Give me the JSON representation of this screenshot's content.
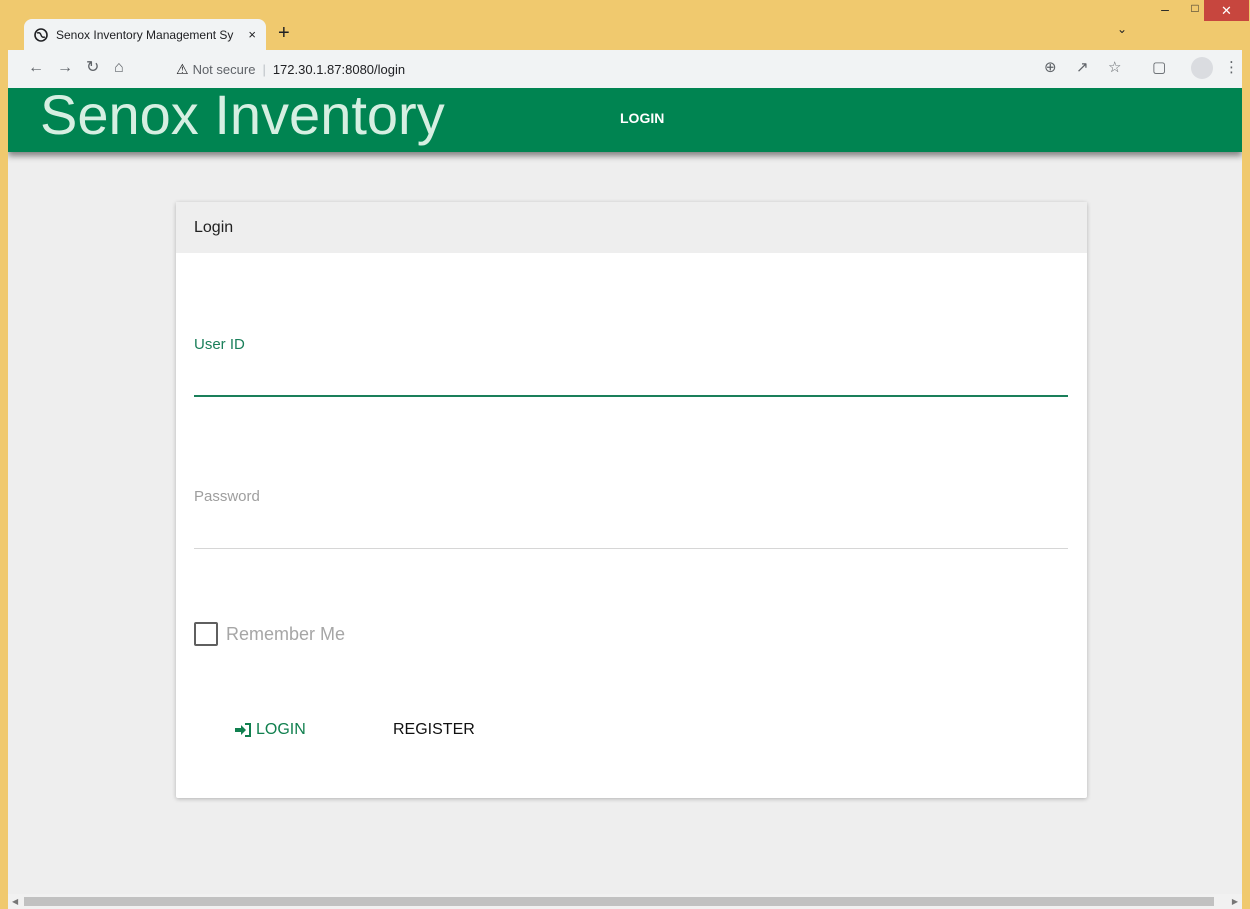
{
  "browser": {
    "tab_title": "Senox Inventory Management Sy",
    "tab_close": "×",
    "new_tab": "+",
    "not_secure": "Not secure",
    "separator": "|",
    "url": "172.30.1.87:8080/login",
    "icons": [
      "globe-icon",
      "back-icon",
      "forward-icon",
      "reload-icon",
      "home-icon",
      "warning-icon",
      "zoom-icon",
      "share-icon",
      "bookmark-star-icon",
      "side-panel-icon",
      "profile-icon",
      "menu-icon",
      "tab-search-icon",
      "minimize-icon",
      "maximize-icon",
      "close-icon"
    ]
  },
  "app": {
    "brand": "Senox Inventory",
    "nav_login": "LOGIN",
    "colors": {
      "header": "#008451",
      "accent": "#1a7f5a"
    }
  },
  "login_card": {
    "title": "Login",
    "user_id_label": "User ID",
    "user_id_value": "",
    "password_label": "Password",
    "password_value": "",
    "remember_me_label": "Remember Me",
    "remember_me_checked": false,
    "login_button": "LOGIN",
    "register_button": "REGISTER"
  }
}
